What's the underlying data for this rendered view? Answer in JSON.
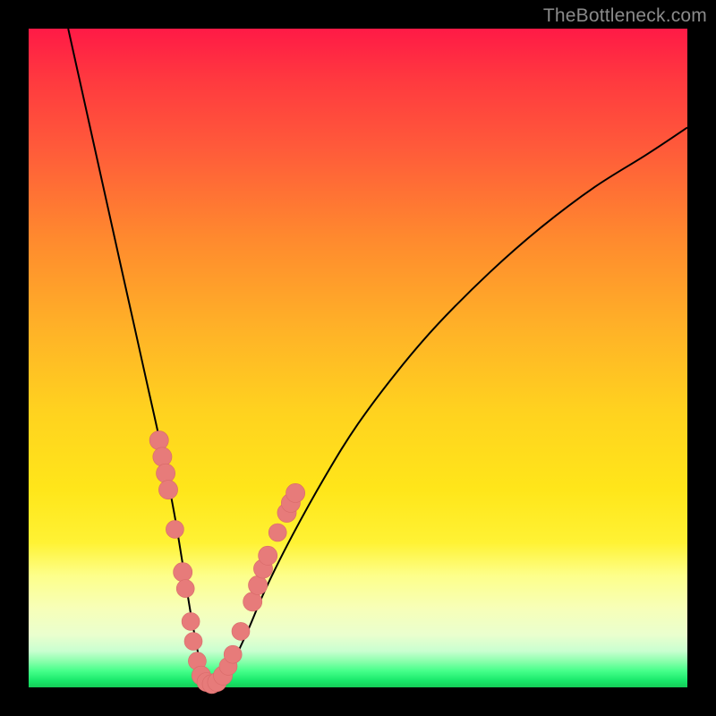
{
  "watermark": "TheBottleneck.com",
  "colors": {
    "frame": "#000000",
    "curve": "#000000",
    "marker_fill": "#e77b7a",
    "marker_stroke": "#d86a69"
  },
  "chart_data": {
    "type": "line",
    "title": "",
    "xlabel": "",
    "ylabel": "",
    "xlim": [
      0,
      100
    ],
    "ylim": [
      0,
      100
    ],
    "grid": false,
    "series": [
      {
        "name": "bottleneck-curve",
        "x": [
          6,
          8,
          10,
          12,
          14,
          16,
          18,
          20,
          22,
          23.5,
          25,
          26.5,
          28,
          30,
          33,
          36,
          40,
          45,
          50,
          56,
          62,
          70,
          78,
          86,
          94,
          100
        ],
        "y": [
          100,
          91,
          82,
          73,
          64,
          55,
          46,
          37,
          27,
          18,
          9,
          2,
          0.5,
          2,
          8,
          15,
          23,
          32,
          40,
          48,
          55,
          63,
          70,
          76,
          81,
          85
        ]
      }
    ],
    "markers": [
      {
        "x": 19.8,
        "y": 37.5,
        "r": 1.0
      },
      {
        "x": 20.3,
        "y": 35.0,
        "r": 1.0
      },
      {
        "x": 20.8,
        "y": 32.5,
        "r": 1.0
      },
      {
        "x": 21.2,
        "y": 30.0,
        "r": 1.0
      },
      {
        "x": 22.2,
        "y": 24.0,
        "r": 0.9
      },
      {
        "x": 23.4,
        "y": 17.5,
        "r": 1.0
      },
      {
        "x": 23.8,
        "y": 15.0,
        "r": 0.9
      },
      {
        "x": 24.6,
        "y": 10.0,
        "r": 0.9
      },
      {
        "x": 25.0,
        "y": 7.0,
        "r": 0.9
      },
      {
        "x": 25.6,
        "y": 4.0,
        "r": 0.9
      },
      {
        "x": 26.2,
        "y": 1.8,
        "r": 1.0
      },
      {
        "x": 27.0,
        "y": 0.8,
        "r": 1.0
      },
      {
        "x": 27.8,
        "y": 0.5,
        "r": 1.0
      },
      {
        "x": 28.6,
        "y": 0.8,
        "r": 1.0
      },
      {
        "x": 29.5,
        "y": 1.8,
        "r": 1.0
      },
      {
        "x": 30.3,
        "y": 3.2,
        "r": 0.9
      },
      {
        "x": 31.0,
        "y": 5.0,
        "r": 0.9
      },
      {
        "x": 32.2,
        "y": 8.5,
        "r": 0.9
      },
      {
        "x": 34.0,
        "y": 13.0,
        "r": 1.0
      },
      {
        "x": 34.8,
        "y": 15.5,
        "r": 1.0
      },
      {
        "x": 35.6,
        "y": 18.0,
        "r": 1.0
      },
      {
        "x": 36.3,
        "y": 20.0,
        "r": 1.0
      },
      {
        "x": 37.8,
        "y": 23.5,
        "r": 0.9
      },
      {
        "x": 39.2,
        "y": 26.5,
        "r": 1.0
      },
      {
        "x": 39.8,
        "y": 28.0,
        "r": 1.0
      },
      {
        "x": 40.5,
        "y": 29.5,
        "r": 1.0
      }
    ]
  }
}
